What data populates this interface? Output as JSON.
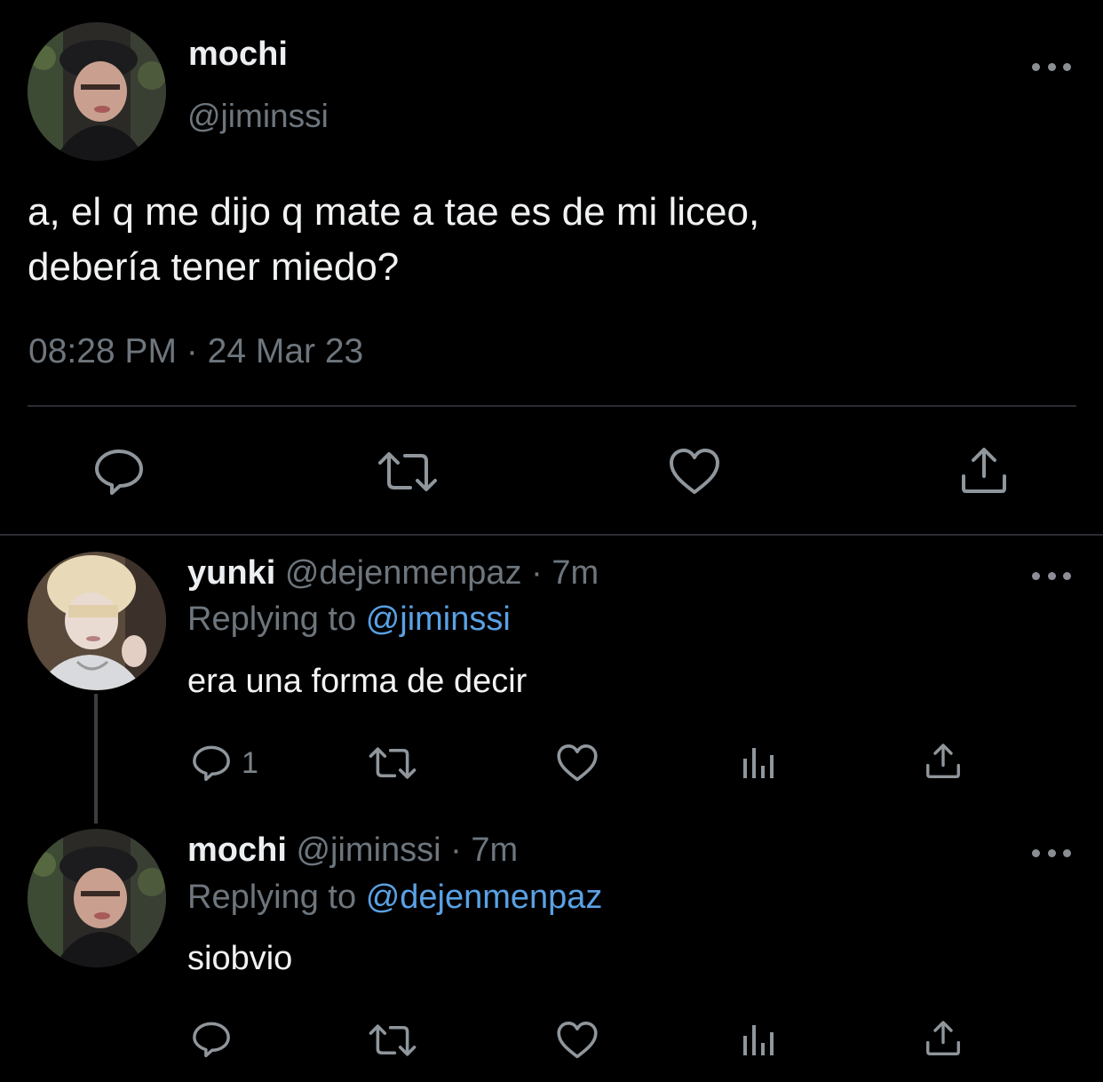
{
  "main_tweet": {
    "display_name": "mochi",
    "handle": "@jiminssi",
    "text_line1": "a, el q me dijo q mate a tae es de mi liceo,",
    "text_line2": "debería tener miedo?",
    "time": "08:28 PM",
    "separator": "·",
    "date": "24 Mar 23",
    "actions": [
      "reply-icon",
      "retweet-icon",
      "like-icon",
      "share-icon"
    ]
  },
  "replies": [
    {
      "display_name": "yunki",
      "handle": "@dejenmenpaz",
      "separator": "·",
      "age": "7m",
      "replying_prefix": "Replying to",
      "replying_to": "@jiminssi",
      "text": "era una forma de decir",
      "reply_count": "1",
      "actions": [
        "reply-icon",
        "retweet-icon",
        "like-icon",
        "analytics-icon",
        "share-icon"
      ]
    },
    {
      "display_name": "mochi",
      "handle": "@jiminssi",
      "separator": "·",
      "age": "7m",
      "replying_prefix": "Replying to",
      "replying_to": "@dejenmenpaz",
      "text": "siobvio",
      "actions": [
        "reply-icon",
        "retweet-icon",
        "like-icon",
        "analytics-icon",
        "share-icon"
      ]
    }
  ],
  "colors": {
    "background": "#000000",
    "text": "#e7e9ea",
    "secondary": "#6e767d",
    "link": "#5aa1e4",
    "divider": "#2a2d31"
  }
}
